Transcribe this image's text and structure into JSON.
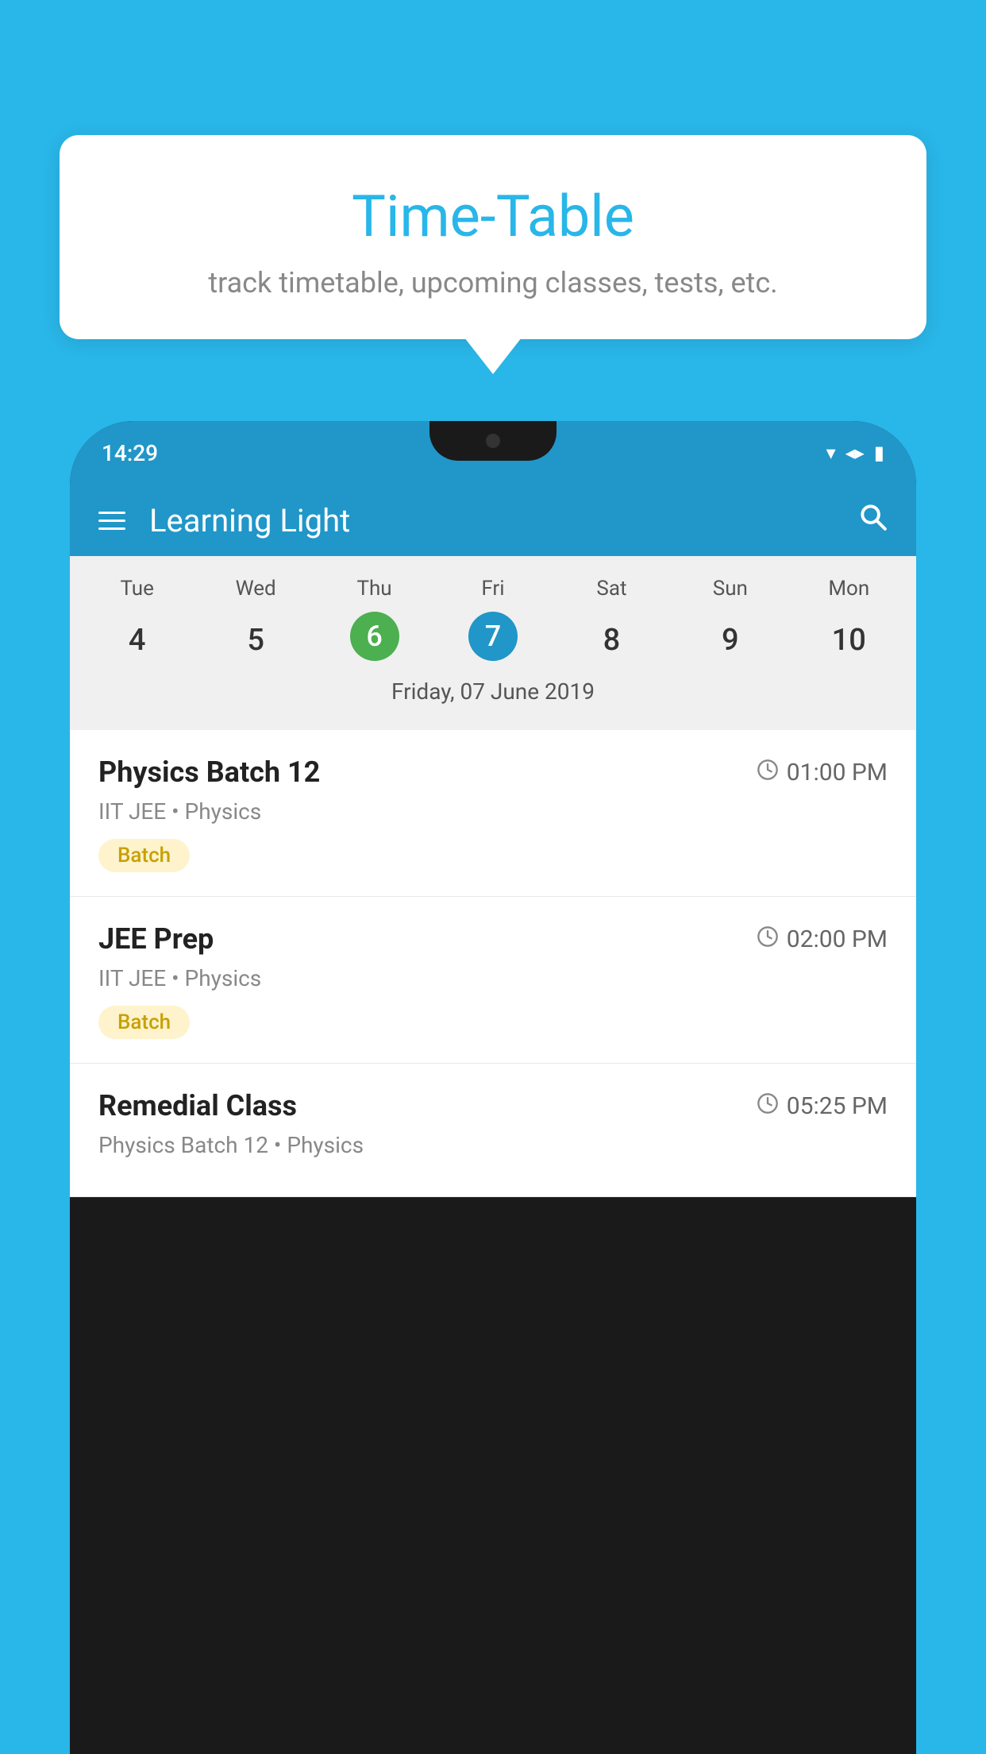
{
  "background": {
    "color": "#29b6e8"
  },
  "tooltip": {
    "title": "Time-Table",
    "subtitle": "track timetable, upcoming classes, tests, etc."
  },
  "phone": {
    "statusBar": {
      "time": "14:29"
    },
    "appBar": {
      "title": "Learning Light"
    },
    "calendar": {
      "days": [
        {
          "label": "Tue",
          "num": "4"
        },
        {
          "label": "Wed",
          "num": "5"
        },
        {
          "label": "Thu",
          "num": "6",
          "state": "today"
        },
        {
          "label": "Fri",
          "num": "7",
          "state": "selected"
        },
        {
          "label": "Sat",
          "num": "8"
        },
        {
          "label": "Sun",
          "num": "9"
        },
        {
          "label": "Mon",
          "num": "10"
        }
      ],
      "selectedDate": "Friday, 07 June 2019"
    },
    "classes": [
      {
        "name": "Physics Batch 12",
        "time": "01:00 PM",
        "meta": "IIT JEE • Physics",
        "badge": "Batch"
      },
      {
        "name": "JEE Prep",
        "time": "02:00 PM",
        "meta": "IIT JEE • Physics",
        "badge": "Batch"
      },
      {
        "name": "Remedial Class",
        "time": "05:25 PM",
        "meta": "Physics Batch 12 • Physics",
        "badge": ""
      }
    ]
  },
  "icons": {
    "hamburger": "☰",
    "search": "🔍",
    "clock": "🕐"
  }
}
